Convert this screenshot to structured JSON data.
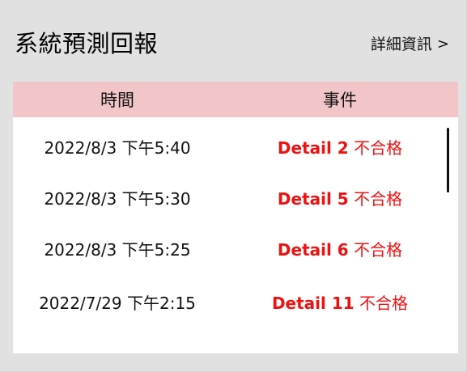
{
  "header": {
    "title": "系統預測回報",
    "detail_link": "詳細資訊",
    "detail_chevron": ">"
  },
  "table": {
    "columns": [
      "時間",
      "事件"
    ],
    "rows": [
      {
        "time": "2022/8/3 下午5:40",
        "event_detail": "Detail 2",
        "event_status": "不合格"
      },
      {
        "time": "2022/8/3 下午5:30",
        "event_detail": "Detail 5",
        "event_status": "不合格"
      },
      {
        "time": "2022/8/3 下午5:25",
        "event_detail": "Detail 6",
        "event_status": "不合格"
      },
      {
        "time": "2022/7/29 下午2:15",
        "event_detail": "Detail 11",
        "event_status": "不合格"
      }
    ]
  },
  "colors": {
    "panel_bg": "#e1e1e1",
    "header_row_bg": "#f2c6c8",
    "event_text": "#ee1111"
  }
}
